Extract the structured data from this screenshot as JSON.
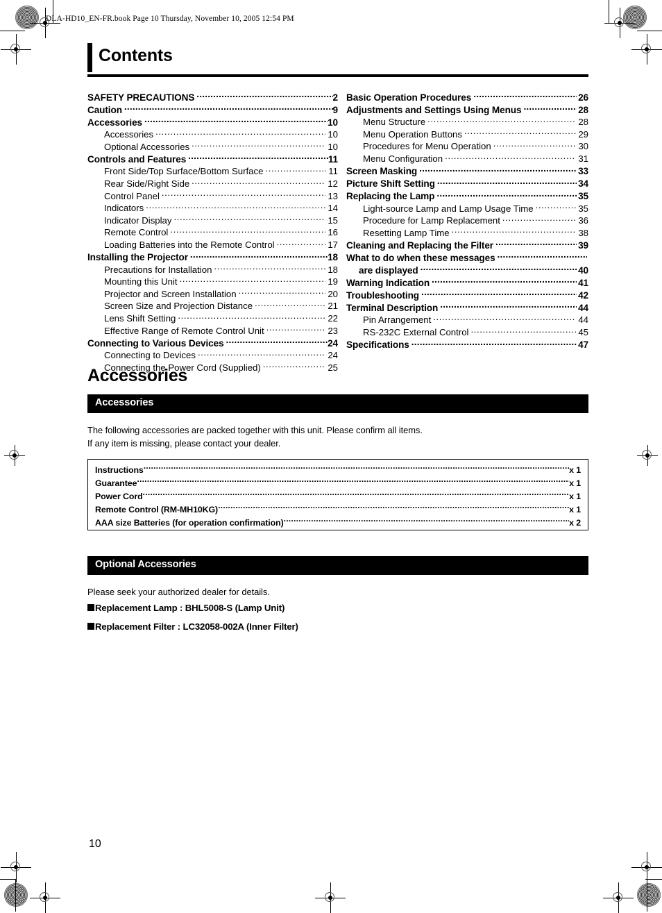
{
  "header": {
    "book_line": "DLA-HD10_EN-FR.book  Page 10  Thursday, November 10, 2005  12:54 PM"
  },
  "contents": {
    "title": "Contents",
    "left_column": [
      {
        "level": 1,
        "label": "SAFETY PRECAUTIONS",
        "page": "2"
      },
      {
        "level": 1,
        "label": "Caution",
        "page": "9"
      },
      {
        "level": 1,
        "label": "Accessories",
        "page": "10"
      },
      {
        "level": 2,
        "label": "Accessories",
        "page": "10"
      },
      {
        "level": 2,
        "label": "Optional Accessories",
        "page": "10"
      },
      {
        "level": 1,
        "label": "Controls and Features",
        "page": "11"
      },
      {
        "level": 2,
        "label": "Front Side/Top Surface/Bottom Surface",
        "page": "11"
      },
      {
        "level": 2,
        "label": "Rear Side/Right Side",
        "page": "12"
      },
      {
        "level": 2,
        "label": "Control Panel",
        "page": "13"
      },
      {
        "level": 2,
        "label": "Indicators",
        "page": "14"
      },
      {
        "level": 2,
        "label": "Indicator Display",
        "page": "15"
      },
      {
        "level": 2,
        "label": "Remote Control",
        "page": "16"
      },
      {
        "level": 2,
        "label": "Loading Batteries into the Remote Control",
        "page": "17"
      },
      {
        "level": 1,
        "label": "Installing the Projector",
        "page": "18"
      },
      {
        "level": 2,
        "label": "Precautions for Installation",
        "page": "18"
      },
      {
        "level": 2,
        "label": "Mounting this Unit",
        "page": "19"
      },
      {
        "level": 2,
        "label": "Projector and Screen Installation",
        "page": "20"
      },
      {
        "level": 2,
        "label": "Screen Size and Projection Distance",
        "page": "21"
      },
      {
        "level": 2,
        "label": "Lens Shift Setting",
        "page": "22"
      },
      {
        "level": 2,
        "label": "Effective Range of Remote Control Unit",
        "page": "23"
      },
      {
        "level": 1,
        "label": "Connecting to Various Devices",
        "page": "24"
      },
      {
        "level": 2,
        "label": "Connecting to Devices",
        "page": "24"
      },
      {
        "level": 2,
        "label": "Connecting the Power Cord (Supplied)",
        "page": "25"
      }
    ],
    "right_column": [
      {
        "level": 1,
        "label": "Basic Operation Procedures",
        "page": "26"
      },
      {
        "level": 1,
        "label": "Adjustments and Settings Using Menus",
        "page": "28"
      },
      {
        "level": 2,
        "label": "Menu Structure",
        "page": "28"
      },
      {
        "level": 2,
        "label": "Menu Operation Buttons",
        "page": "29"
      },
      {
        "level": 2,
        "label": "Procedures for Menu Operation",
        "page": "30"
      },
      {
        "level": 2,
        "label": "Menu Configuration",
        "page": "31"
      },
      {
        "level": 1,
        "label": "Screen Masking",
        "page": "33"
      },
      {
        "level": 1,
        "label": "Picture Shift Setting",
        "page": "34"
      },
      {
        "level": 1,
        "label": "Replacing the Lamp",
        "page": "35"
      },
      {
        "level": 2,
        "label": "Light-source Lamp and Lamp Usage Time",
        "page": "35"
      },
      {
        "level": 2,
        "label": "Procedure for Lamp Replacement",
        "page": "36"
      },
      {
        "level": 2,
        "label": "Resetting Lamp Time",
        "page": "38"
      },
      {
        "level": 1,
        "label": "Cleaning and Replacing the Filter",
        "page": "39"
      },
      {
        "level": 1,
        "label": "What to do when these messages",
        "page": "",
        "nodots": true
      },
      {
        "level": 1,
        "label": "are displayed",
        "page": "40",
        "indent": true
      },
      {
        "level": 1,
        "label": "Warning Indication",
        "page": "41"
      },
      {
        "level": 1,
        "label": "Troubleshooting",
        "page": "42"
      },
      {
        "level": 1,
        "label": "Terminal Description",
        "page": "44"
      },
      {
        "level": 2,
        "label": "Pin Arrangement",
        "page": "44"
      },
      {
        "level": 2,
        "label": "RS-232C External Control",
        "page": "45"
      },
      {
        "level": 1,
        "label": "Specifications",
        "page": "47"
      }
    ]
  },
  "accessories_section": {
    "heading": "Accessories",
    "bar_label": "Accessories",
    "intro_line_1": "The following accessories are packed together with this unit. Please confirm all items.",
    "intro_line_2": "If any item is missing, please contact your dealer.",
    "items": [
      {
        "label": "Instructions",
        "qty": "x 1"
      },
      {
        "label": "Guarantee",
        "qty": "x 1"
      },
      {
        "label": "Power Cord",
        "qty": "x 1"
      },
      {
        "label": "Remote Control (RM-MH10KG)",
        "qty": "x 1"
      },
      {
        "label": "AAA size Batteries (for operation confirmation)",
        "qty": "x 2"
      }
    ]
  },
  "optional_section": {
    "bar_label": "Optional Accessories",
    "intro": "Please seek your authorized dealer for details.",
    "items": [
      {
        "label": "Replacement Lamp : BHL5008-S (Lamp Unit)"
      },
      {
        "label": "Replacement Filter  : LC32058-002A (Inner Filter)"
      }
    ]
  },
  "footer": {
    "page_number": "10"
  },
  "colors": {
    "ink": "#000000",
    "paper": "#ffffff",
    "bar_background": "#000000",
    "bar_text": "#ffffff"
  }
}
